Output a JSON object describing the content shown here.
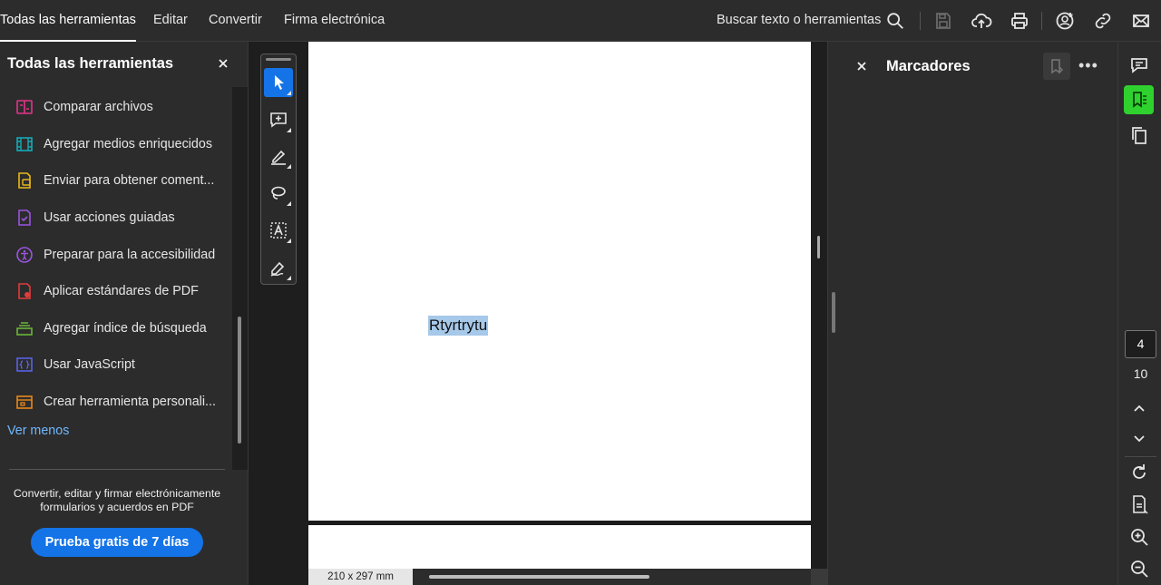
{
  "nav": {
    "items": [
      "Todas las herramientas",
      "Editar",
      "Convertir",
      "Firma electrónica"
    ],
    "search_label": "Buscar texto o herramientas"
  },
  "tools_panel": {
    "title": "Todas las herramientas",
    "items": [
      {
        "label": "Comparar archivos",
        "icon": "compare-files-icon",
        "color": "#e3348a"
      },
      {
        "label": "Agregar medios enriquecidos",
        "icon": "rich-media-icon",
        "color": "#16a9b8"
      },
      {
        "label": "Enviar para obtener coment...",
        "icon": "send-comments-icon",
        "color": "#e8b81a"
      },
      {
        "label": "Usar acciones guiadas",
        "icon": "guided-actions-icon",
        "color": "#9b55e0"
      },
      {
        "label": "Preparar para la accesibilidad",
        "icon": "accessibility-icon",
        "color": "#9b55e0"
      },
      {
        "label": "Aplicar estándares de PDF",
        "icon": "pdf-standards-icon",
        "color": "#e23b3b"
      },
      {
        "label": "Agregar índice de búsqueda",
        "icon": "search-index-icon",
        "color": "#6ab63a"
      },
      {
        "label": "Usar JavaScript",
        "icon": "javascript-icon",
        "color": "#5a62e6"
      },
      {
        "label": "Crear herramienta personali...",
        "icon": "custom-tool-icon",
        "color": "#e8881a"
      }
    ],
    "see_less": "Ver menos",
    "promo_text": "Convertir, editar y firmar electrónicamente formularios y acuerdos en PDF",
    "promo_button": "Prueba gratis de 7 días"
  },
  "document": {
    "selected_text": "Rtyrtrytu",
    "page_size": "210 x 297 mm"
  },
  "bookmarks": {
    "title": "Marcadores"
  },
  "pagination": {
    "current": "4",
    "total": "10"
  }
}
